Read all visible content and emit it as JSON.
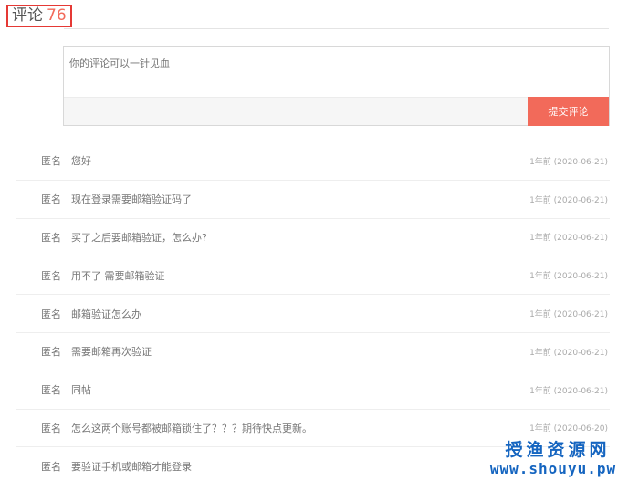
{
  "header": {
    "label": "评论",
    "count": "76"
  },
  "comment_box": {
    "placeholder": "你的评论可以一针见血",
    "submit_label": "提交评论"
  },
  "comments": [
    {
      "author": "匿名",
      "text": "您好",
      "time": "1年前 (2020-06-21)"
    },
    {
      "author": "匿名",
      "text": "现在登录需要邮箱验证码了",
      "time": "1年前 (2020-06-21)"
    },
    {
      "author": "匿名",
      "text": "买了之后要邮箱验证，怎么办?",
      "time": "1年前 (2020-06-21)"
    },
    {
      "author": "匿名",
      "text": "用不了 需要邮箱验证",
      "time": "1年前 (2020-06-21)"
    },
    {
      "author": "匿名",
      "text": "邮箱验证怎么办",
      "time": "1年前 (2020-06-21)"
    },
    {
      "author": "匿名",
      "text": "需要邮箱再次验证",
      "time": "1年前 (2020-06-21)"
    },
    {
      "author": "匿名",
      "text": "同帖",
      "time": "1年前 (2020-06-21)"
    },
    {
      "author": "匿名",
      "text": "怎么这两个账号都被邮箱锁住了？？？期待快点更新。",
      "time": "1年前 (2020-06-20)"
    },
    {
      "author": "匿名",
      "text": "要验证手机或邮箱才能登录",
      "time": ""
    }
  ],
  "watermark": {
    "title": "授渔资源网",
    "url": "www.shouyu.pw"
  },
  "colors": {
    "accent": "#f26a5a",
    "highlight_border": "#e53935",
    "watermark": "#1565c0"
  }
}
